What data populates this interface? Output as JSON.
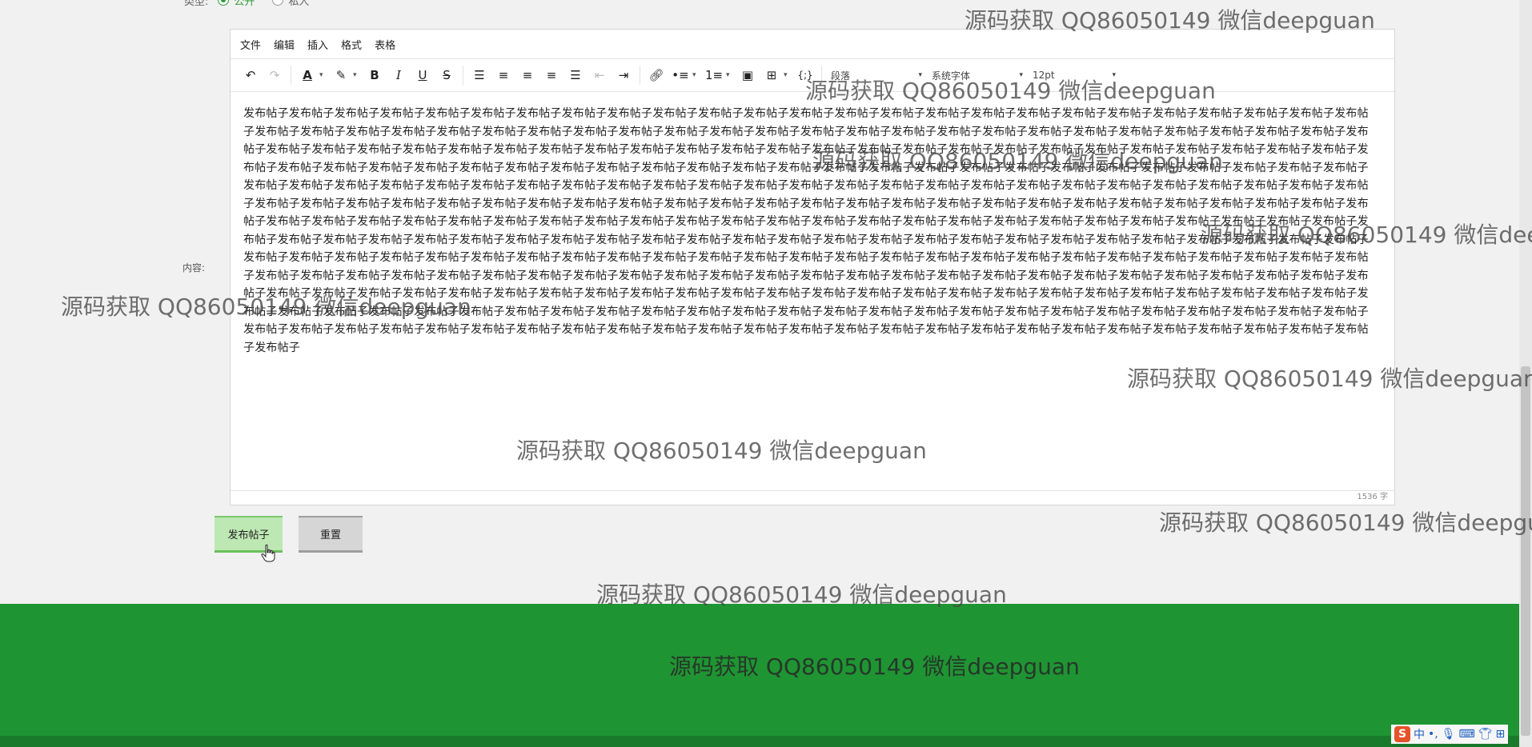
{
  "form": {
    "type_label": "类型:",
    "type_options": [
      "公开",
      "私人"
    ],
    "content_label": "内容:"
  },
  "editor": {
    "menu": [
      "文件",
      "编辑",
      "插入",
      "格式",
      "表格"
    ],
    "paragraph_select": "段落",
    "font_select": "系统字体",
    "size_select": "12pt",
    "body_text": "发布帖子发布帖子发布帖子发布帖子发布帖子发布帖子发布帖子发布帖子发布帖子发布帖子发布帖子发布帖子发布帖子发布帖子发布帖子发布帖子发布帖子发布帖子发布帖子发布帖子发布帖子发布帖子发布帖子发布帖子发布帖子发布帖子发布帖子发布帖子发布帖子发布帖子发布帖子发布帖子发布帖子发布帖子发布帖子发布帖子发布帖子发布帖子发布帖子发布帖子发布帖子发布帖子发布帖子发布帖子发布帖子发布帖子发布帖子发布帖子发布帖子发布帖子发布帖子发布帖子发布帖子发布帖子发布帖子发布帖子发布帖子发布帖子发布帖子发布帖子发布帖子发布帖子发布帖子发布帖子发布帖子发布帖子发布帖子发布帖子发布帖子发布帖子发布帖子发布帖子发布帖子发布帖子发布帖子发布帖子发布帖子发布帖子发布帖子发布帖子发布帖子发布帖子发布帖子发布帖子发布帖子发布帖子发布帖子发布帖子发布帖子发布帖子发布帖子发布帖子发布帖子发布帖子发布帖子发布帖子发布帖子发布帖子发布帖子发布帖子发布帖子发布帖子发布帖子发布帖子发布帖子发布帖子发布帖子发布帖子发布帖子发布帖子发布帖子发布帖子发布帖子发布帖子发布帖子发布帖子发布帖子发布帖子发布帖子发布帖子发布帖子发布帖子发布帖子发布帖子发布帖子发布帖子发布帖子发布帖子发布帖子发布帖子发布帖子发布帖子发布帖子发布帖子发布帖子发布帖子发布帖子发布帖子发布帖子发布帖子发布帖子发布帖子发布帖子发布帖子发布帖子发布帖子发布帖子发布帖子发布帖子发布帖子发布帖子发布帖子发布帖子发布帖子发布帖子发布帖子发布帖子发布帖子发布帖子发布帖子发布帖子发布帖子发布帖子发布帖子发布帖子发布帖子发布帖子发布帖子发布帖子发布帖子发布帖子发布帖子发布帖子发布帖子发布帖子发布帖子发布帖子发布帖子发布帖子发布帖子发布帖子发布帖子发布帖子发布帖子发布帖子发布帖子发布帖子发布帖子发布帖子发布帖子发布帖子发布帖子发布帖子发布帖子发布帖子发布帖子发布帖子发布帖子发布帖子发布帖子发布帖子发布帖子发布帖子发布帖子发布帖子发布帖子发布帖子发布帖子发布帖子发布帖子发布帖子发布帖子发布帖子发布帖子发布帖子发布帖子发布帖子发布帖子发布帖子发布帖子发布帖子发布帖子发布帖子发布帖子发布帖子发布帖子发布帖子发布帖子发布帖子发布帖子发布帖子发布帖子发布帖子发布帖子发布帖子发布帖子发布帖子发布帖子发布帖子发布帖子发布帖子发布帖子发布帖子发布帖子发布帖子发布帖子发布帖子发布帖子发布帖子发布帖子发布帖子发布帖子发布帖子发布帖子发布帖子发布帖子发布帖子发布帖子发布帖子发布帖子发布帖子发布帖子发布帖子发布帖子发布帖子发布帖子发布帖子发布帖子发布帖子发布帖子发布帖子发布帖子发布帖子发布帖子发布帖子发布帖子发布帖子发布帖子发布帖子发布帖子发布帖子发布帖子发布帖子发布帖子发布帖子发布帖子发布帖子发布帖子发布帖子发布帖子发布帖子发布帖子发布帖子发布帖子发布帖子发布帖子发布帖子发布帖子发布帖子发布帖子发布帖子发布帖子发布帖子发布帖子发布帖子发布帖子发布帖子发布帖子发布帖子发布帖子发布帖子发布帖子发布帖子发布帖子发布帖子发布帖子发布帖子发布帖子发布帖子发布帖子发布帖子发布帖子发布帖子",
    "word_count": "1536 字"
  },
  "buttons": {
    "publish": "发布帖子",
    "reset": "重置"
  },
  "watermark": "源码获取 QQ86050149 微信deepguan",
  "ime": {
    "lang": "中",
    "punct": "•,",
    "icons": [
      "mic-icon",
      "keyboard-icon",
      "shirt-icon",
      "grid-icon"
    ]
  },
  "colors": {
    "accent": "#2e9b3a",
    "footer": "#1f9433"
  }
}
